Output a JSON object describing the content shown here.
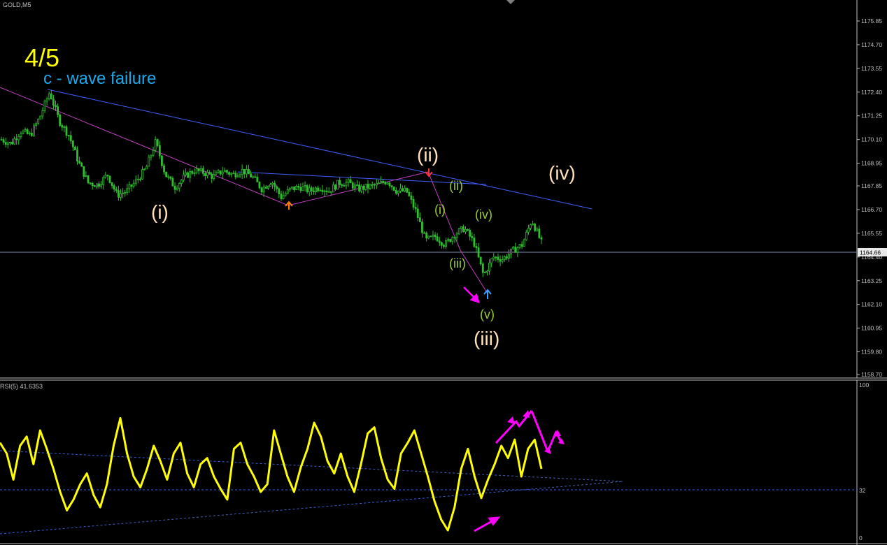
{
  "window": {
    "title": "GOLD,M5"
  },
  "colors": {
    "background": "#000000",
    "candle": "#2fbf2f",
    "axis_text": "#c0c0c0",
    "trendline_blue": "#3f5fff",
    "trendline_magenta": "#c03fc0",
    "rsi_line": "#ffff00",
    "rsi_dashed": "#3f5fcf",
    "arrow_magenta": "#ff00ff",
    "label_cream": "#ffe0b8",
    "label_green": "#9acd32",
    "label_yellow": "#ffff00",
    "label_cyan": "#1fa8e8"
  },
  "annotations": {
    "wave_count": "4/5",
    "wave_note": "c - wave failure",
    "i": "(i)",
    "ii": "(ii)",
    "iii": "(iii)",
    "iv": "(iv)",
    "sub_i": "(i)",
    "sub_ii": "(ii)",
    "sub_iii": "(iii)",
    "sub_iv": "(iv)",
    "sub_v": "(v)"
  },
  "indicator": {
    "label": "RSI(5) 41.6353",
    "level_top": "100",
    "level_mid": "32",
    "level_bottom": "0"
  },
  "chart_data": [
    {
      "type": "candlestick",
      "symbol": "GOLD",
      "timeframe": "M5",
      "y_ticks": [
        "1175.85",
        "1174.70",
        "1173.55",
        "1172.40",
        "1171.25",
        "1170.10",
        "1168.95",
        "1167.85",
        "1166.70",
        "1165.55",
        "1164.40",
        "1163.25",
        "1162.10",
        "1160.95",
        "1159.80",
        "1158.70"
      ],
      "ylim": [
        1158.7,
        1176.1
      ],
      "current_price": "1164.66",
      "close_approx": [
        1170.1,
        1169.9,
        1170.5,
        1170.3,
        1171.2,
        1172.4,
        1171.0,
        1170.3,
        1169.0,
        1168.0,
        1167.9,
        1168.4,
        1167.4,
        1167.6,
        1168.1,
        1168.7,
        1170.0,
        1168.4,
        1167.8,
        1168.3,
        1168.6,
        1168.5,
        1168.3,
        1168.6,
        1168.4,
        1168.6,
        1168.3,
        1167.7,
        1168.1,
        1167.3,
        1167.7,
        1167.8,
        1167.6,
        1167.8,
        1167.6,
        1168.0,
        1168.0,
        1167.7,
        1167.8,
        1167.9,
        1168.1,
        1167.6,
        1167.6,
        1166.6,
        1165.2,
        1165.4,
        1165.0,
        1165.5,
        1165.8,
        1165.1,
        1163.5,
        1164.4,
        1164.3,
        1164.7,
        1165.0,
        1166.2,
        1165.1
      ]
    },
    {
      "type": "line",
      "name": "RSI(5)",
      "ylim": [
        0,
        100
      ],
      "levels": [
        32
      ],
      "values": [
        62,
        55,
        38,
        60,
        66,
        48,
        70,
        58,
        45,
        30,
        18,
        25,
        35,
        42,
        28,
        20,
        35,
        60,
        78,
        55,
        40,
        33,
        45,
        60,
        50,
        38,
        55,
        62,
        42,
        33,
        48,
        52,
        40,
        32,
        25,
        58,
        62,
        48,
        40,
        30,
        35,
        70,
        55,
        40,
        30,
        46,
        58,
        75,
        66,
        50,
        42,
        55,
        40,
        30,
        48,
        68,
        72,
        52,
        38,
        32,
        55,
        62,
        70,
        55,
        40,
        24,
        12,
        5,
        20,
        45,
        58,
        40,
        26,
        38,
        48,
        60,
        52,
        64,
        40,
        58,
        64,
        45
      ]
    }
  ]
}
